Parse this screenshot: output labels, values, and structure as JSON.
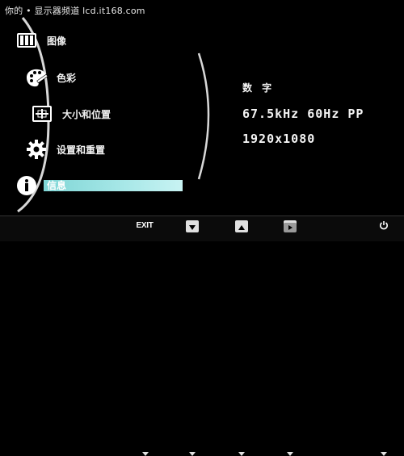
{
  "watermark": "你的 • 显示器频道 lcd.it168.com",
  "menu": {
    "items": [
      {
        "label": "图像",
        "icon": "picture-bars-icon"
      },
      {
        "label": "色彩",
        "icon": "palette-icon"
      },
      {
        "label": "大小和位置",
        "icon": "size-position-icon"
      },
      {
        "label": "设置和重置",
        "icon": "gear-icon"
      },
      {
        "label": "信息",
        "icon": "info-icon",
        "selected": true
      }
    ]
  },
  "info": {
    "input_label": "数 字",
    "frequency": "67.5kHz 60Hz PP",
    "resolution": "1920x1080"
  },
  "buttons": {
    "exit_label": "EXIT",
    "down_icon": "down-arrow-icon",
    "up_icon": "up-arrow-icon",
    "right_icon": "play-right-icon",
    "power_icon": "power-icon"
  },
  "colors": {
    "highlight": "#a9e8e8",
    "background": "#000000"
  }
}
